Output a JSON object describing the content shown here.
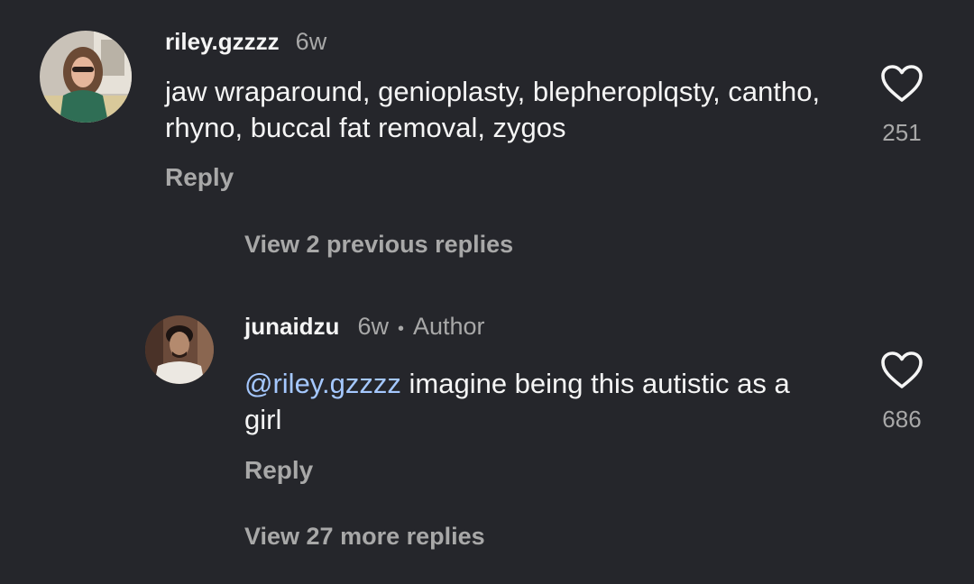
{
  "comments": [
    {
      "username": "riley.gzzzz",
      "age": "6w",
      "text": "jaw wraparound, genioplasty, blepheroplqsty, cantho, rhyno, buccal fat removal, zygos",
      "likes": "251",
      "reply_label": "Reply",
      "avatar_icon": "profile-photo"
    },
    {
      "username": "junaidzu",
      "age": "6w",
      "separator": "•",
      "badge": "Author",
      "mention": "@riley.gzzzz",
      "text": "imagine being this autistic as a girl",
      "likes": "686",
      "reply_label": "Reply",
      "avatar_icon": "profile-photo"
    }
  ],
  "thread": {
    "view_previous": "View 2 previous replies",
    "view_more": "View 27 more replies"
  },
  "icons": {
    "like": "heart-outline-icon"
  },
  "colors": {
    "background": "#25262b",
    "primary_text": "#f5f5f5",
    "secondary_text": "#a8a8a8",
    "mention": "#a5c8ff"
  }
}
